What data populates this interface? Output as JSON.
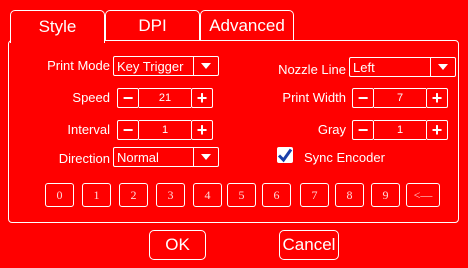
{
  "tabs": [
    {
      "label": "Style"
    },
    {
      "label": "DPI"
    },
    {
      "label": "Advanced"
    }
  ],
  "form": {
    "print_mode": {
      "label": "Print Mode",
      "value": "Key Trigger"
    },
    "speed": {
      "label": "Speed",
      "value": "21"
    },
    "interval": {
      "label": "Interval",
      "value": "1"
    },
    "direction": {
      "label": "Direction",
      "value": "Normal"
    },
    "nozzle_line": {
      "label": "Nozzle Line",
      "value": "Left"
    },
    "print_width": {
      "label": "Print Width",
      "value": "7"
    },
    "gray": {
      "label": "Gray",
      "value": "1"
    },
    "sync_encoder": {
      "label": "Sync Encoder",
      "checked": true
    }
  },
  "stepper_symbols": {
    "minus": "−",
    "plus": "+"
  },
  "keypad": {
    "keys": [
      "0",
      "1",
      "2",
      "3",
      "4",
      "5",
      "6",
      "7",
      "8",
      "9"
    ],
    "backspace": "<—"
  },
  "buttons": {
    "ok": "OK",
    "cancel": "Cancel"
  },
  "colors": {
    "background": "#ff0000",
    "foreground": "#ffffff",
    "check": "#1a3fa8"
  }
}
